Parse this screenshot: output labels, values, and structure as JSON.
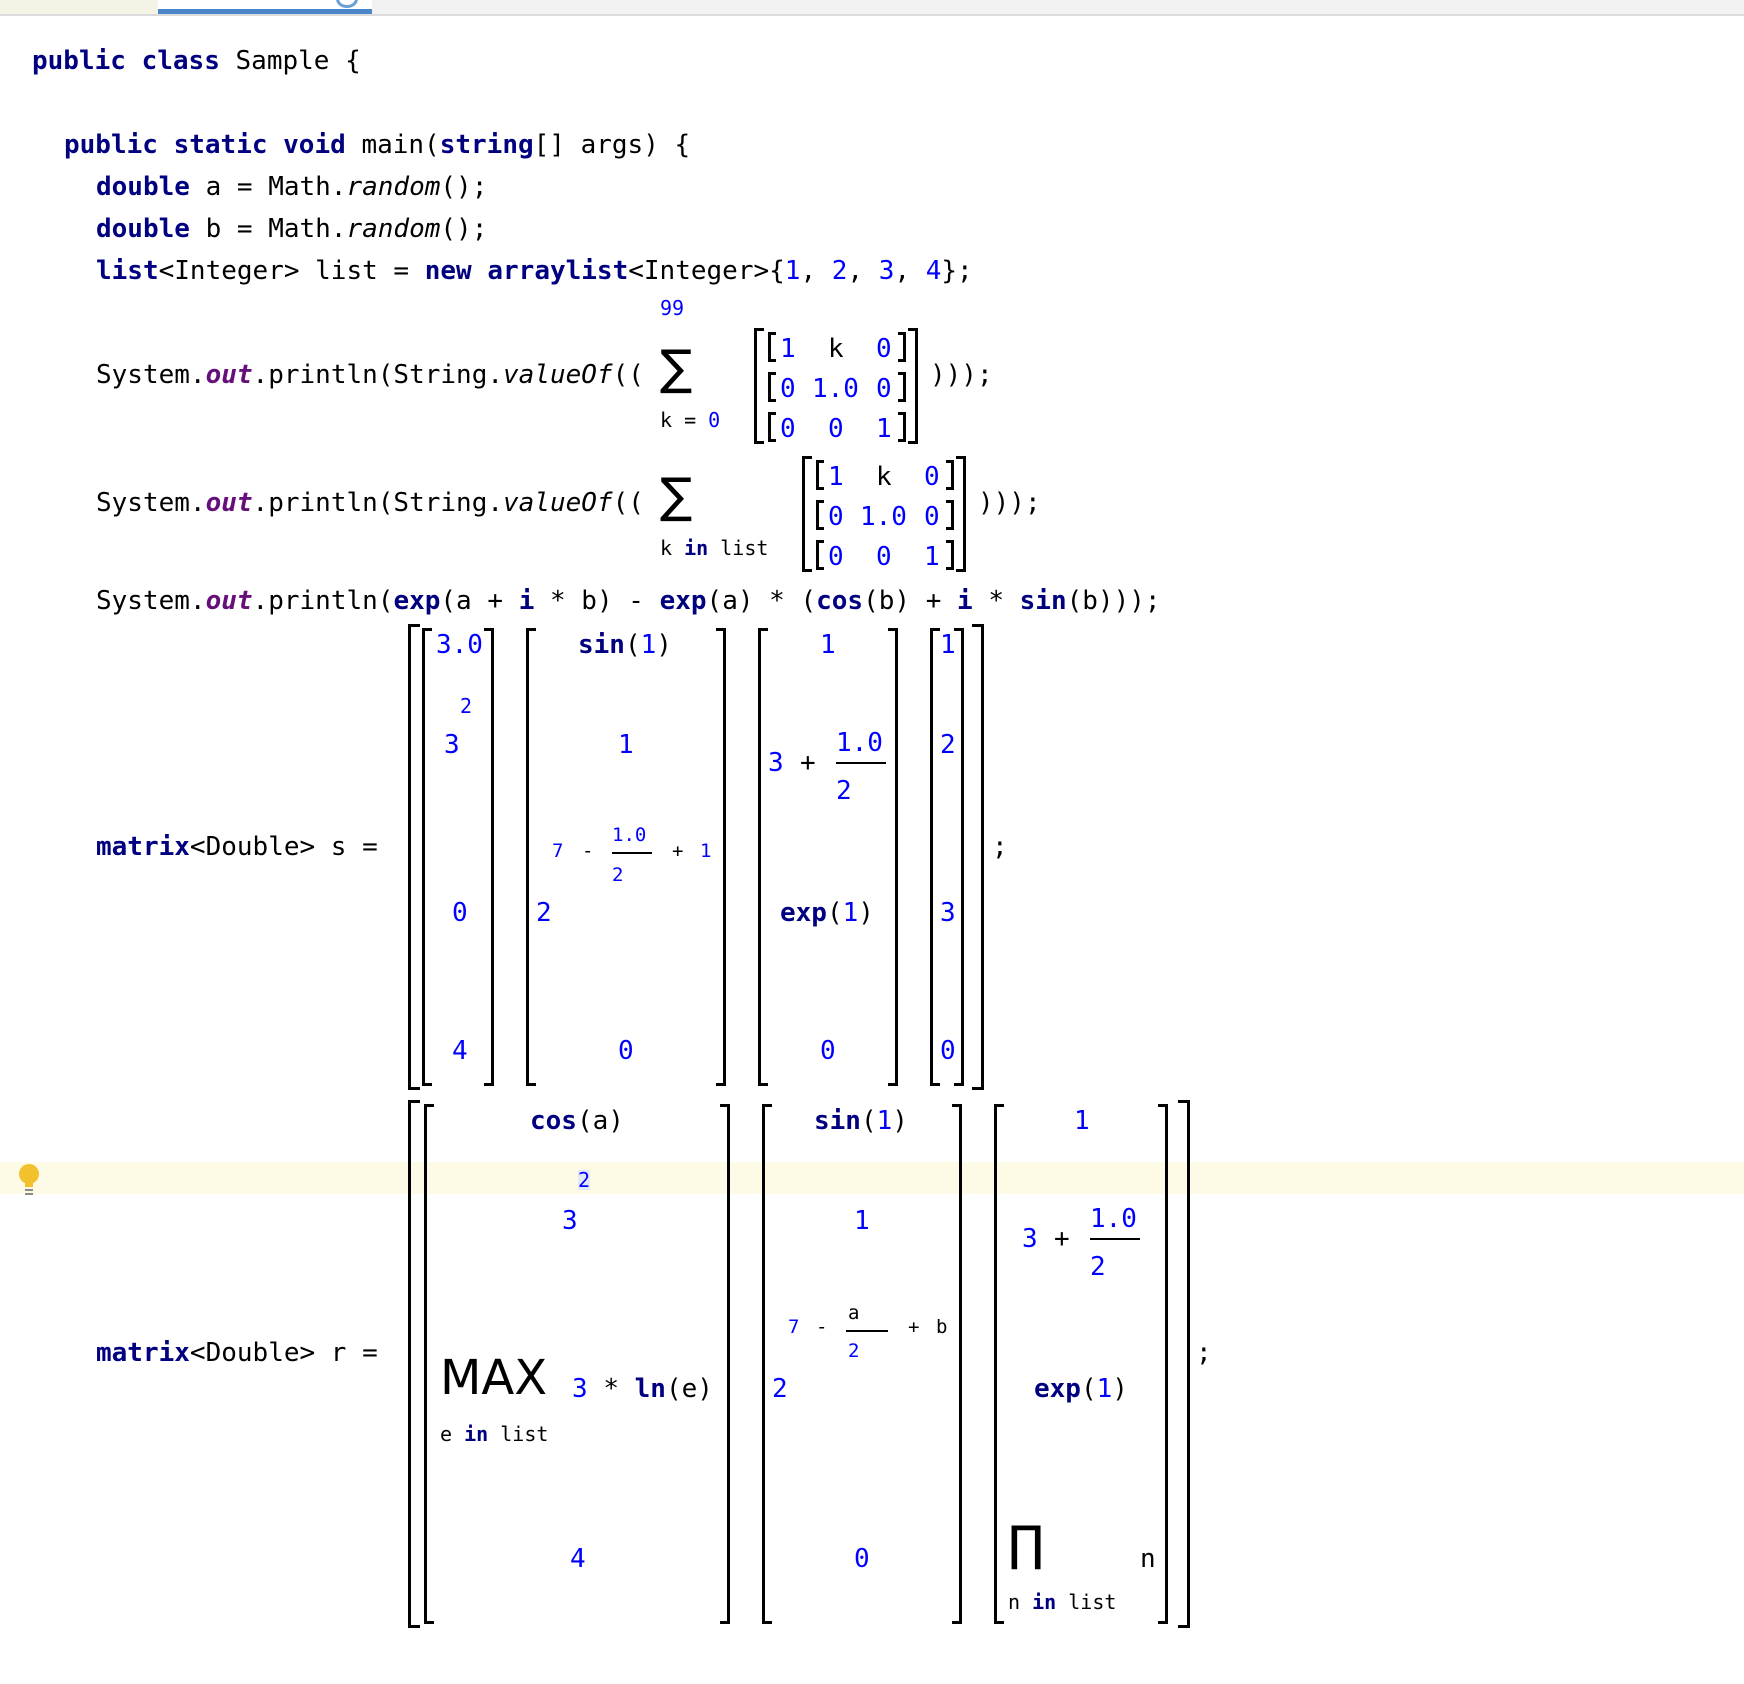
{
  "line_class": {
    "kw1": "public",
    "kw2": "class",
    "rest": "Sample {"
  },
  "line_main": {
    "kw1": "public",
    "kw2": "static",
    "kw3": "void",
    "mid": "main(",
    "kw4": "string",
    "rest": "[] args) {"
  },
  "line_a": {
    "kw": "double",
    "mid": "a = Math.",
    "method": "random",
    "rest": "();"
  },
  "line_b": {
    "kw": "double",
    "mid": "b = Math.",
    "method": "random",
    "rest": "();"
  },
  "line_list": {
    "kw1": "list",
    "t1": "<Integer> list =",
    "kw2": "new",
    "kw3": "arraylist",
    "t2": "<Integer>{",
    "n1": "1",
    "c1": ",",
    "n2": "2",
    "c2": ",",
    "n3": "3",
    "c3": ",",
    "n4": "4",
    "end": "};"
  },
  "print": {
    "system": "System.",
    "out": "out",
    "println": ".println(String.",
    "valueof": "valueOf",
    "open": "((",
    "close": ")));",
    "sigma": "∑"
  },
  "sum1": {
    "upper": "99",
    "lower_var": "k =",
    "lower_num": "0"
  },
  "sum2": {
    "lower_var": "k",
    "lower_in": "in",
    "lower_list": "list"
  },
  "mat3": {
    "r1": [
      "1",
      "k",
      "0"
    ],
    "r2": [
      "0",
      "1.0",
      "0"
    ],
    "r3": [
      "0",
      "0",
      "1"
    ]
  },
  "line_exp": {
    "p1": "System.",
    "out": "out",
    "p2": ".println(",
    "exp": "exp",
    "p3": "(a +",
    "i": "i",
    "p4": "* b) -",
    "p5": "(a) * (",
    "cos": "cos",
    "p6": "(b) +",
    "p7": "*",
    "sin": "sin",
    "p8": "(b)));"
  },
  "matrix_s": {
    "decl_kw": "matrix",
    "decl_rest": "<Double> s =",
    "semicolon": ";",
    "c1": {
      "v1": "3.0",
      "pow": "2",
      "base": "3",
      "v3": "0",
      "v4": "4"
    },
    "c2": {
      "fn": "sin",
      "lp": "(",
      "arg": "1",
      "rp": ")",
      "v2": "1",
      "seven": "7",
      "minus": "-",
      "fnum": "1.0",
      "fden": "2",
      "plus": "+",
      "one": "1",
      "two": "2",
      "zero": "0"
    },
    "c3": {
      "v1": "1",
      "three": "3",
      "plus": "+",
      "fnum": "1.0",
      "fden": "2",
      "exp": "exp",
      "lp": "(",
      "arg": "1",
      "rp": ")",
      "zero": "0"
    },
    "c4": {
      "v1": "1",
      "v2": "2",
      "v3": "3",
      "v4": "0"
    }
  },
  "matrix_r": {
    "decl_kw": "matrix",
    "decl_rest": "<Double> r =",
    "semicolon": ";",
    "c1": {
      "cos": "cos",
      "cos_arg": "(a)",
      "pow": "2",
      "base": "3",
      "max": "MAX",
      "three": "3",
      "mul": "*",
      "ln": "ln",
      "ln_arg": "(e)",
      "sub_e": "e",
      "sub_in": "in",
      "sub_list": "list",
      "four": "4"
    },
    "c2": {
      "sin": "sin",
      "lp": "(",
      "arg": "1",
      "rp": ")",
      "one": "1",
      "seven": "7",
      "minus": "-",
      "fnum": "a",
      "fden": "2",
      "plus": "+",
      "b": "b",
      "two": "2",
      "zero": "0"
    },
    "c3": {
      "one": "1",
      "three": "3",
      "plus": "+",
      "fnum": "1.0",
      "fden": "2",
      "exp": "exp",
      "lp": "(",
      "arg": "1",
      "rp": ")",
      "prod": "∏",
      "n": "n",
      "sub_n": "n",
      "sub_in": "in",
      "sub_list": "list"
    }
  }
}
